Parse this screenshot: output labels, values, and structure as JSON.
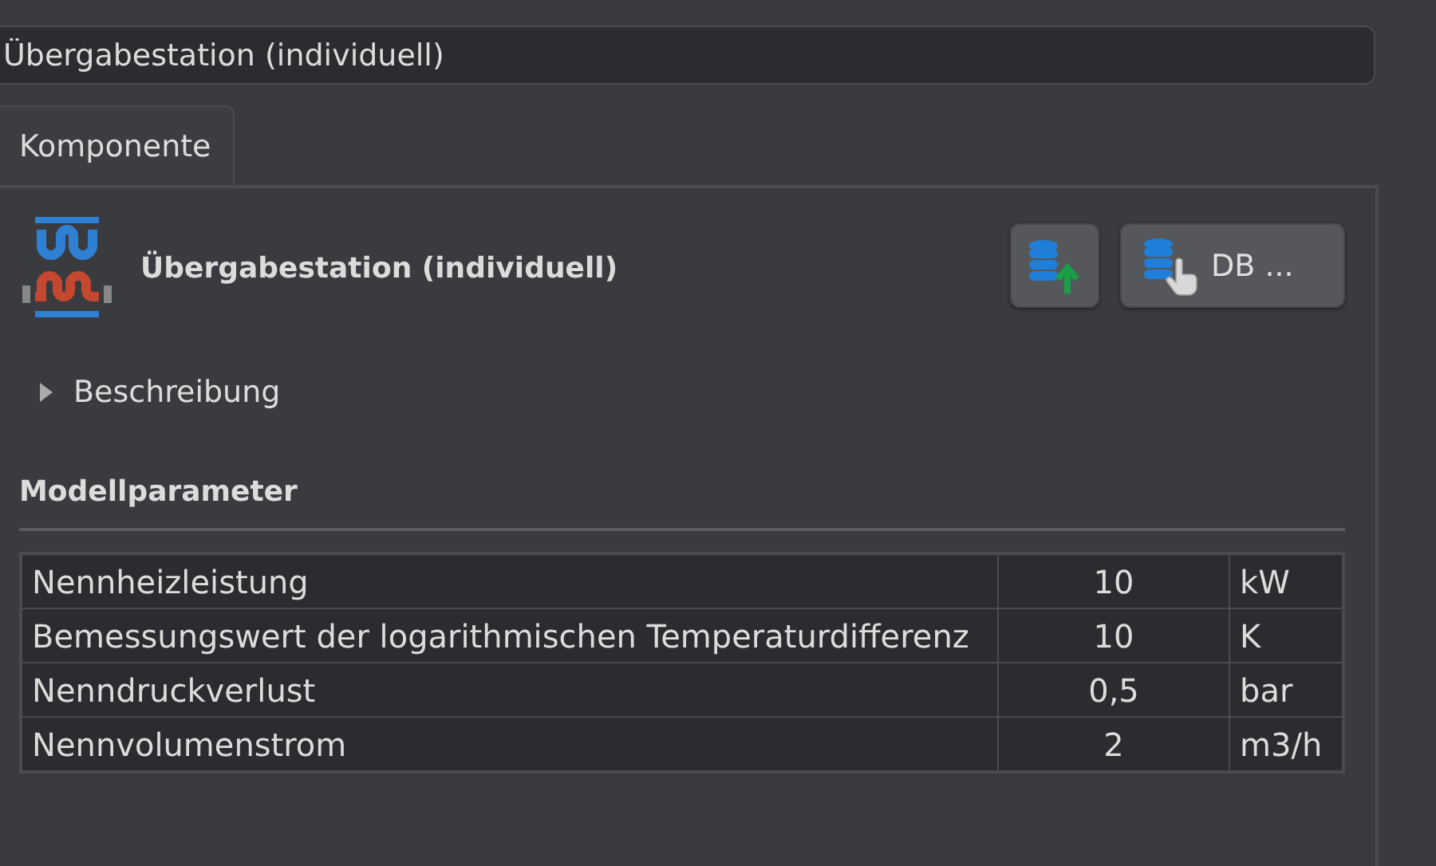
{
  "name_field": {
    "value": "Übergabestation (individuell)"
  },
  "tabs": [
    {
      "label": "Komponente",
      "selected": true
    }
  ],
  "component": {
    "title": "Übergabestation (individuell)",
    "buttons": [
      {
        "kind": "upload"
      },
      {
        "kind": "select",
        "label": "DB ..."
      }
    ]
  },
  "description": {
    "label": "Beschreibung",
    "expanded": false
  },
  "parameters": {
    "heading": "Modellparameter",
    "rows": [
      {
        "name": "Nennheizleistung",
        "value": "10",
        "unit": "kW"
      },
      {
        "name": "Bemessungswert der logarithmischen Temperaturdifferenz",
        "value": "10",
        "unit": "K"
      },
      {
        "name": "Nenndruckverlust",
        "value": "0,5",
        "unit": "bar"
      },
      {
        "name": "Nennvolumenstrom",
        "value": "2",
        "unit": "m3/h"
      }
    ]
  }
}
